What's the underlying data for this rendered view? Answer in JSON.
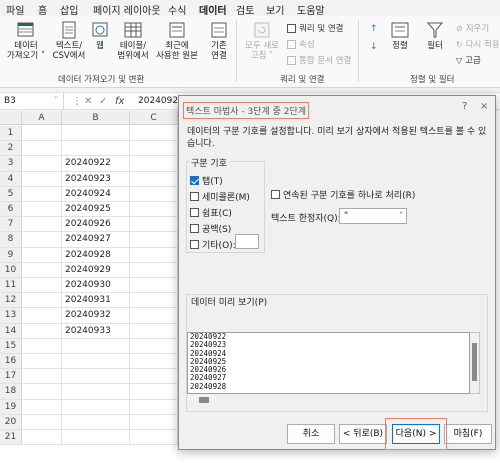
{
  "menu": {
    "items": [
      "파일",
      "홈",
      "삽입",
      "페이지 레이아웃",
      "수식",
      "데이터",
      "검토",
      "보기",
      "도움말"
    ],
    "active": "데이터"
  },
  "ribbon": {
    "get_data": "데이터\n가져오기 ˅",
    "from_text_csv": "텍스트/\nCSV에서",
    "from_web": "웹",
    "from_table_range": "테이블/\n범위에서",
    "recent_sources": "최근에\n사용한 원본",
    "existing_connections": "기존\n연결",
    "group_get_transform": "데이터 가져오기 및 변환",
    "refresh_all": "모두 새로\n고침 ˅",
    "queries_connections": "쿼리 및 연결",
    "properties": "속성",
    "edit_links": "통합 문서 연결",
    "group_queries": "쿼리 및 연결",
    "sort": "정렬",
    "filter": "필터",
    "clear": "지우기",
    "reapply": "다시 적용",
    "advanced": "고급",
    "group_sort_filter": "정렬 및 필터"
  },
  "formula_bar": {
    "name_box": "B3",
    "value": "20240922"
  },
  "grid": {
    "columns": [
      "A",
      "B",
      "C"
    ],
    "rows": [
      "1",
      "2",
      "3",
      "4",
      "5",
      "6",
      "7",
      "8",
      "9",
      "10",
      "11",
      "12",
      "13",
      "14",
      "15",
      "16",
      "17",
      "18",
      "19",
      "20",
      "21"
    ],
    "b_values": [
      "20240922",
      "20240923",
      "20240924",
      "20240925",
      "20240926",
      "20240927",
      "20240928",
      "20240929",
      "20240930",
      "20240931",
      "20240932",
      "20240933"
    ]
  },
  "dialog": {
    "title": "텍스트 마법사 - 3단계 중 2단계",
    "help": "?",
    "close": "×",
    "description": "데이터의 구분 기호를 설정합니다. 미리 보기 상자에서 적용된 텍스트를 볼 수 있습니다.",
    "delimiters_title": "구분 기호",
    "tab": "탭(T)",
    "semicolon": "세미콜론(M)",
    "comma": "쉼표(C)",
    "space": "공백(S)",
    "other": "기타(O):",
    "consecutive": "연속된 구분 기호를 하나로 처리(R)",
    "text_qualifier_label": "텍스트 한정자(Q):",
    "text_qualifier_value": "\"",
    "preview_title": "데이터 미리 보기(P)",
    "preview_lines": [
      "20240922",
      "20240923",
      "20240924",
      "20240925",
      "20240926",
      "20240927",
      "20240928"
    ],
    "cancel": "취소",
    "back": "< 뒤로(B)",
    "next": "다음(N) >",
    "finish": "마침(F)"
  },
  "colors": {
    "accent": "#1e7145",
    "highlight": "#e9806a",
    "check": "#1a6fc4"
  }
}
